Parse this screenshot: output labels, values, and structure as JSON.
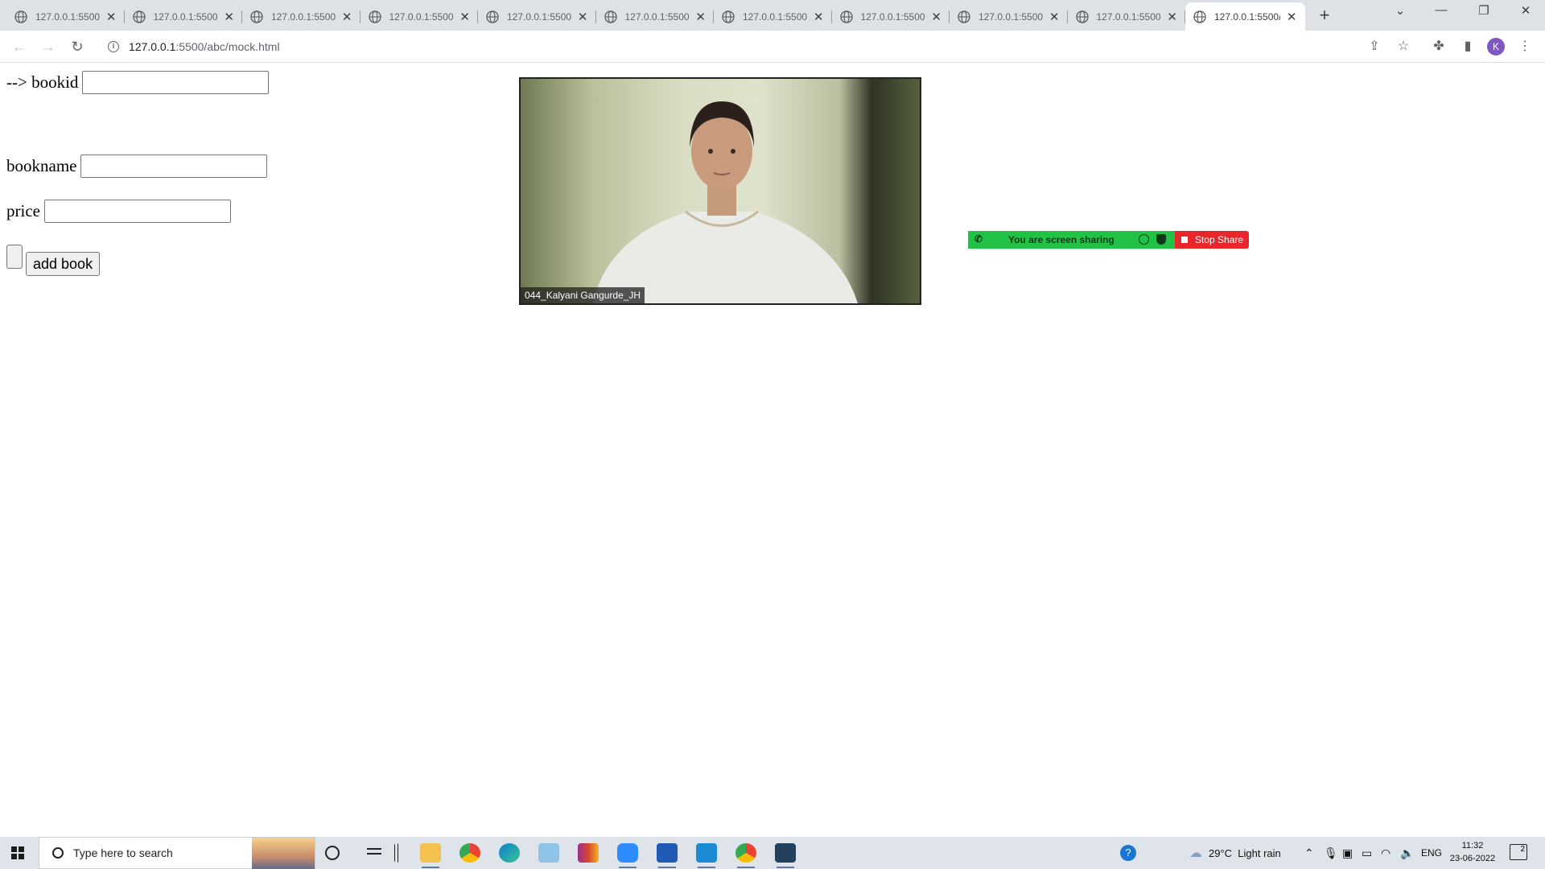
{
  "browser": {
    "tabs": [
      {
        "title": "127.0.0.1:5500/"
      },
      {
        "title": "127.0.0.1:5500/"
      },
      {
        "title": "127.0.0.1:5500/"
      },
      {
        "title": "127.0.0.1:5500/"
      },
      {
        "title": "127.0.0.1:5500/"
      },
      {
        "title": "127.0.0.1:5500/"
      },
      {
        "title": "127.0.0.1:5500/"
      },
      {
        "title": "127.0.0.1:5500/"
      },
      {
        "title": "127.0.0.1:5500/"
      },
      {
        "title": "127.0.0.1:5500/"
      },
      {
        "title": "127.0.0.1:5500/",
        "active": true
      }
    ],
    "url_host": "127.0.0.1",
    "url_rest": ":5500/abc/mock.html",
    "profile_initial": "K"
  },
  "form": {
    "bookid_label": "--> bookid",
    "bookid_value": "",
    "bookname_label": "bookname",
    "bookname_value": "",
    "price_label": "price",
    "price_value": "",
    "submit_label": "add book"
  },
  "meeting": {
    "participant_name": "044_Kalyani Gangurde_JH",
    "share_status": "You are screen sharing",
    "stop_share_label": "Stop Share",
    "share_green": "#21c246",
    "stop_red": "#e8262b"
  },
  "taskbar": {
    "search_placeholder": "Type here to search",
    "apps": [
      "task-view-icon",
      "widgets-icon",
      "file-explorer-icon",
      "chrome-icon",
      "edge-icon",
      "notepad-icon",
      "winrar-icon",
      "zoom-icon",
      "word-icon",
      "vscode-icon",
      "chrome-profile-icon",
      "mysql-workbench-icon"
    ],
    "weather_temp": "29°C",
    "weather_desc": "Light rain",
    "language": "ENG",
    "time": "11:32",
    "date": "23-06-2022",
    "notification_count": "2"
  }
}
